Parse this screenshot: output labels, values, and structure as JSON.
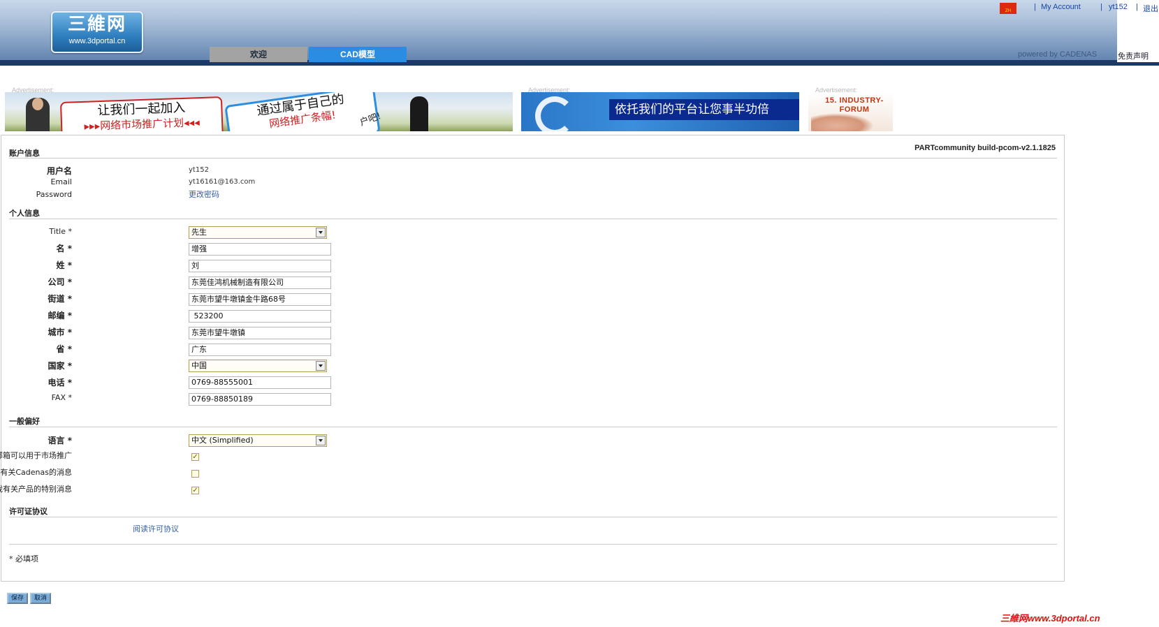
{
  "header": {
    "logo_main": "三維网",
    "logo_url": "www.3dportal.cn",
    "tabs": [
      {
        "label": "欢迎"
      },
      {
        "label": "CAD模型"
      }
    ],
    "flag_text": "ZH",
    "top_links": {
      "sep": "|",
      "my_account": "My Account",
      "user": "yt152",
      "logout": "退出"
    },
    "powered_by": "powered by CADENAS",
    "disclaimer": "免责声明"
  },
  "ads": {
    "label": "Advertisement:",
    "ad1": {
      "card1_line1": "让我们一起加入",
      "card1_line2": "▸▸▸网络市场推广计划◂◂◂",
      "card2_line1": "通过属于自己的",
      "card2_line2": "网络推广条幅!",
      "card2_side": "户吧!"
    },
    "ad2": {
      "slogan": "依托我们的平台让您事半功倍"
    },
    "ad3": {
      "title": "15. INDUSTRY-FORUM"
    }
  },
  "panel": {
    "build": "PARTcommunity build-pcom-v2.1.1825",
    "account": {
      "title": "账户信息",
      "username_label": "用户名",
      "username": "yt152",
      "email_label": "Email",
      "email": "yt16161@163.com",
      "password_label": "Password",
      "change_password": "更改密码"
    },
    "personal": {
      "title": "个人信息",
      "title_label": "Title",
      "title_value": "先生",
      "first_name_label": "名",
      "first_name": "增强",
      "last_name_label": "姓",
      "last_name": "刘",
      "company_label": "公司",
      "company": "东莞佳鸿机械制造有限公司",
      "street_label": "街道",
      "street": "东莞市望牛墩镇金牛路68号",
      "zip_label": "邮编",
      "zip": " 523200",
      "city_label": "城市",
      "city": "东莞市望牛墩镇",
      "province_label": "省",
      "province": "广东",
      "country_label": "国家",
      "country": "中国",
      "phone_label": "电话",
      "phone": "0769-88555001",
      "fax_label": "FAX",
      "fax": "0769-88850189"
    },
    "prefs": {
      "title": "一般偏好",
      "language_label": "语言",
      "language": "中文 (Simplified)",
      "opt1_label": "我同意将我的邮箱可以用于市场推广",
      "opt1_checked": true,
      "opt2_label": "发送给我有关Cadenas的消息",
      "opt2_checked": false,
      "opt3_label": "发送给我有关产品的特别消息",
      "opt3_checked": true
    },
    "license": {
      "title": "许可证协议",
      "read_link": "阅读许可协议"
    },
    "required_note": "* 必填项",
    "req_mark": "*"
  },
  "buttons": {
    "save": "保存",
    "cancel": "取消"
  },
  "footer": {
    "logo": "三維网www.3dportal.cn"
  }
}
